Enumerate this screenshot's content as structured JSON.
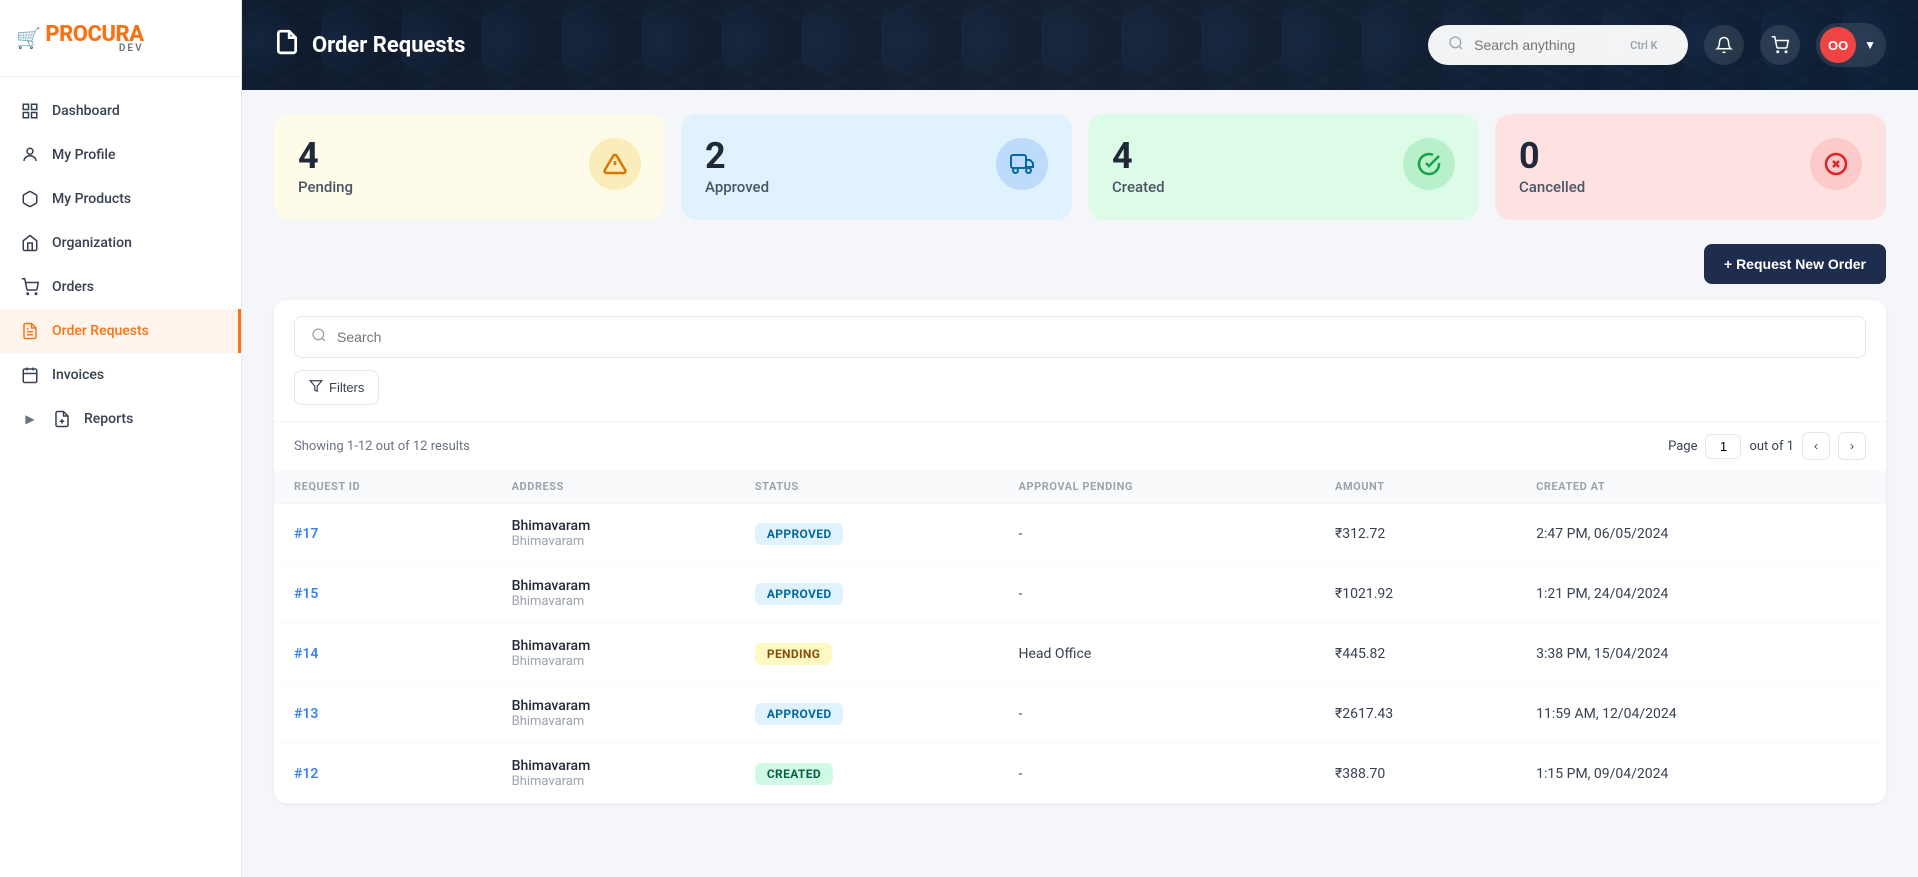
{
  "app": {
    "name": "PROCURA",
    "sub": "DEV",
    "logo_icon": "🛒"
  },
  "sidebar": {
    "items": [
      {
        "id": "dashboard",
        "label": "Dashboard",
        "icon": "⊞",
        "active": false
      },
      {
        "id": "my-profile",
        "label": "My Profile",
        "icon": "👤",
        "active": false
      },
      {
        "id": "my-products",
        "label": "My Products",
        "icon": "📦",
        "active": false
      },
      {
        "id": "organization",
        "label": "Organization",
        "icon": "🏢",
        "active": false
      },
      {
        "id": "orders",
        "label": "Orders",
        "icon": "🛒",
        "active": false
      },
      {
        "id": "order-requests",
        "label": "Order Requests",
        "icon": "🧾",
        "active": true
      },
      {
        "id": "invoices",
        "label": "Invoices",
        "icon": "📋",
        "active": false
      },
      {
        "id": "reports",
        "label": "Reports",
        "icon": "📊",
        "active": false,
        "has_chevron": true
      }
    ]
  },
  "header": {
    "title": "Order Requests",
    "title_icon": "🛒",
    "search_placeholder": "Search anything",
    "search_shortcut": "Ctrl K",
    "avatar_initials": "OO"
  },
  "stats": [
    {
      "id": "pending",
      "number": "4",
      "label": "Pending",
      "color": "yellow",
      "icon": "⚠"
    },
    {
      "id": "approved",
      "number": "2",
      "label": "Approved",
      "color": "blue",
      "icon": "🚚"
    },
    {
      "id": "created",
      "number": "4",
      "label": "Created",
      "color": "green",
      "icon": "✓"
    },
    {
      "id": "cancelled",
      "number": "0",
      "label": "Cancelled",
      "color": "red",
      "icon": "✕"
    }
  ],
  "action": {
    "new_order_label": "+ Request New Order"
  },
  "table": {
    "search_placeholder": "Search",
    "filter_label": "Filters",
    "results_text": "Showing 1-12 out of 12 results",
    "page_label": "Page",
    "page_current": "1",
    "page_total_label": "out of 1",
    "columns": [
      "REQUEST ID",
      "ADDRESS",
      "STATUS",
      "APPROVAL PENDING",
      "AMOUNT",
      "CREATED AT"
    ],
    "rows": [
      {
        "id": "#17",
        "address_main": "Bhimavaram",
        "address_sub": "Bhimavaram",
        "status": "APPROVED",
        "status_type": "approved",
        "approval_pending": "-",
        "amount": "₹312.72",
        "created_at": "2:47 PM, 06/05/2024"
      },
      {
        "id": "#15",
        "address_main": "Bhimavaram",
        "address_sub": "Bhimavaram",
        "status": "APPROVED",
        "status_type": "approved",
        "approval_pending": "-",
        "amount": "₹1021.92",
        "created_at": "1:21 PM, 24/04/2024"
      },
      {
        "id": "#14",
        "address_main": "Bhimavaram",
        "address_sub": "Bhimavaram",
        "status": "PENDING",
        "status_type": "pending",
        "approval_pending": "Head Office",
        "amount": "₹445.82",
        "created_at": "3:38 PM, 15/04/2024"
      },
      {
        "id": "#13",
        "address_main": "Bhimavaram",
        "address_sub": "Bhimavaram",
        "status": "APPROVED",
        "status_type": "approved",
        "approval_pending": "-",
        "amount": "₹2617.43",
        "created_at": "11:59 AM, 12/04/2024"
      },
      {
        "id": "#12",
        "address_main": "Bhimavaram",
        "address_sub": "Bhimavaram",
        "status": "CREATED",
        "status_type": "created",
        "approval_pending": "-",
        "amount": "₹388.70",
        "created_at": "1:15 PM, 09/04/2024"
      }
    ]
  }
}
